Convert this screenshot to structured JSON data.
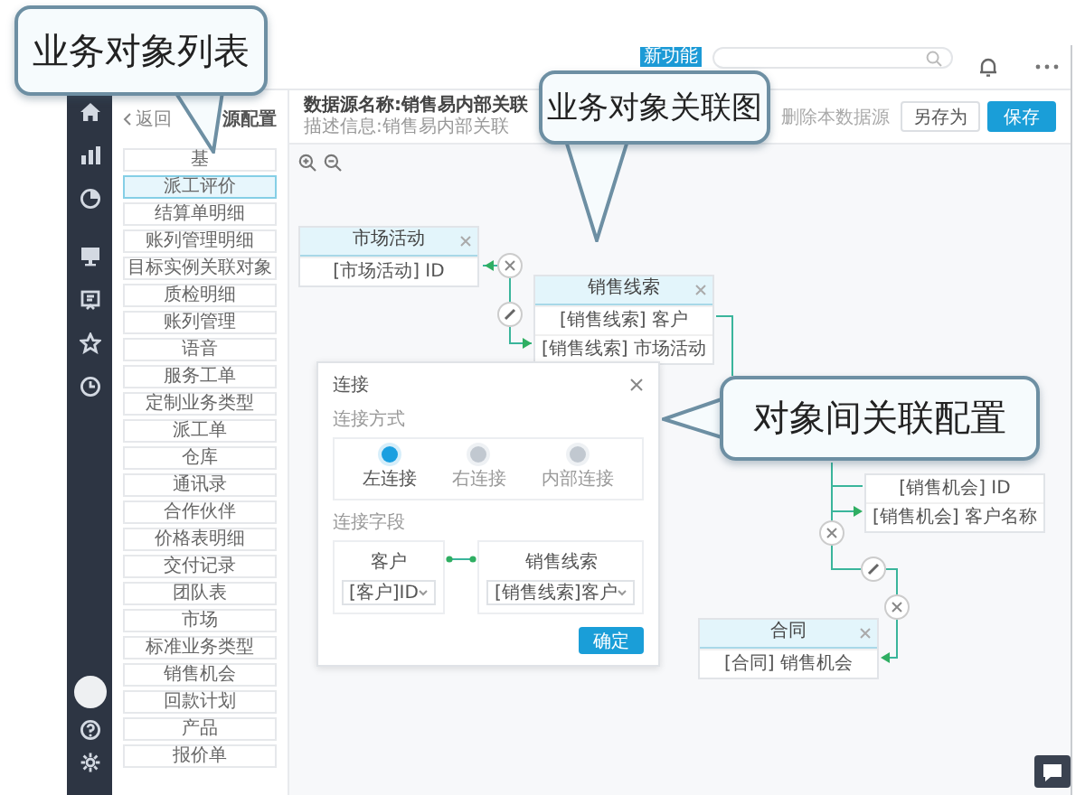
{
  "top_bar": {
    "badge": "新功能"
  },
  "object_panel": {
    "back_link": "返回",
    "title": "源配置",
    "items": [
      {
        "label": "基",
        "selected": false
      },
      {
        "label": "派工评价",
        "selected": true
      },
      {
        "label": "结算单明细",
        "selected": false
      },
      {
        "label": "账列管理明细",
        "selected": false
      },
      {
        "label": "目标实例关联对象",
        "selected": false
      },
      {
        "label": "质检明细",
        "selected": false
      },
      {
        "label": "账列管理",
        "selected": false
      },
      {
        "label": "语音",
        "selected": false
      },
      {
        "label": "服务工单",
        "selected": false
      },
      {
        "label": "定制业务类型",
        "selected": false
      },
      {
        "label": "派工单",
        "selected": false
      },
      {
        "label": "仓库",
        "selected": false
      },
      {
        "label": "通讯录",
        "selected": false
      },
      {
        "label": "合作伙伴",
        "selected": false
      },
      {
        "label": "价格表明细",
        "selected": false
      },
      {
        "label": "交付记录",
        "selected": false
      },
      {
        "label": "团队表",
        "selected": false
      },
      {
        "label": "市场",
        "selected": false
      },
      {
        "label": "标准业务类型",
        "selected": false
      },
      {
        "label": "销售机会",
        "selected": false
      },
      {
        "label": "回款计划",
        "selected": false
      },
      {
        "label": "产品",
        "selected": false
      },
      {
        "label": "报价单",
        "selected": false
      }
    ]
  },
  "header": {
    "name": "数据源名称:销售易内部关联",
    "description": "描述信息:销售易内部关联",
    "buttons": [
      {
        "label": "删除本数据源",
        "kind": "link"
      },
      {
        "label": "另存为",
        "kind": "secondary"
      },
      {
        "label": "保存",
        "kind": "primary"
      }
    ]
  },
  "canvas": {
    "nodes": [
      {
        "title": "市场活动",
        "fields": [
          "[市场活动] ID"
        ]
      },
      {
        "title": "销售线索",
        "fields": [
          "[销售线索] 客户",
          "[销售线索] 市场活动"
        ]
      },
      {
        "fields": [
          "[销售机会] ID",
          "[销售机会] 客户名称"
        ]
      },
      {
        "title": "合同",
        "fields": [
          "[合同] 销售机会"
        ]
      }
    ]
  },
  "dialog": {
    "title": "连接",
    "join_label": "连接方式",
    "join_types": [
      {
        "label": "左连接",
        "selected": true
      },
      {
        "label": "右连接",
        "selected": false
      },
      {
        "label": "内部连接",
        "selected": false
      }
    ],
    "fields_label": "连接字段",
    "field_pairs": [
      {
        "object": "客户",
        "value": "[客户]ID"
      },
      {
        "object": "销售线索",
        "value": "[销售线索]客户"
      }
    ],
    "confirm": "确定"
  },
  "callouts": [
    {
      "text": "业务对象列表"
    },
    {
      "text": "业务对象关联图"
    },
    {
      "text": "对象间关联配置"
    }
  ]
}
